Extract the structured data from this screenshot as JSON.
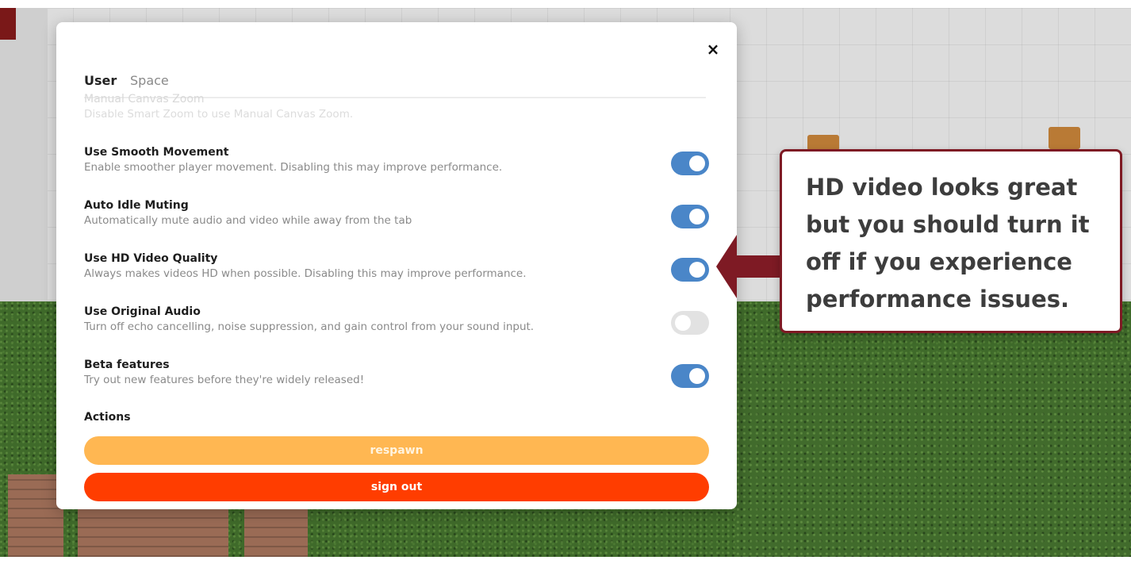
{
  "tabs": {
    "user": "User",
    "space": "Space"
  },
  "close_symbol": "×",
  "settings": [
    {
      "title": "Manual Canvas Zoom",
      "description": "Disable Smart Zoom to use Manual Canvas Zoom.",
      "disabled": true
    },
    {
      "title": "Use Smooth Movement",
      "description": "Enable smoother player movement. Disabling this may improve performance.",
      "enabled": true
    },
    {
      "title": "Auto Idle Muting",
      "description": "Automatically mute audio and video while away from the tab",
      "enabled": true
    },
    {
      "title": "Use HD Video Quality",
      "description": "Always makes videos HD when possible. Disabling this may improve performance.",
      "enabled": true
    },
    {
      "title": "Use Original Audio",
      "description": "Turn off echo cancelling, noise suppression, and gain control from your sound input.",
      "enabled": false
    },
    {
      "title": "Beta features",
      "description": "Try out new features before they're widely released!",
      "enabled": true
    }
  ],
  "actions": {
    "label": "Actions",
    "respawn": "respawn",
    "sign_out": "sign out"
  },
  "annotation": {
    "text": "HD video looks great but you should turn it off if you experience performance issues."
  },
  "colors": {
    "toggle_on": "#4a86c8",
    "toggle_off": "#e2e2e2",
    "respawn": "#ffb752",
    "sign_out": "#ff3d00",
    "callout_border": "#7e1a24"
  }
}
